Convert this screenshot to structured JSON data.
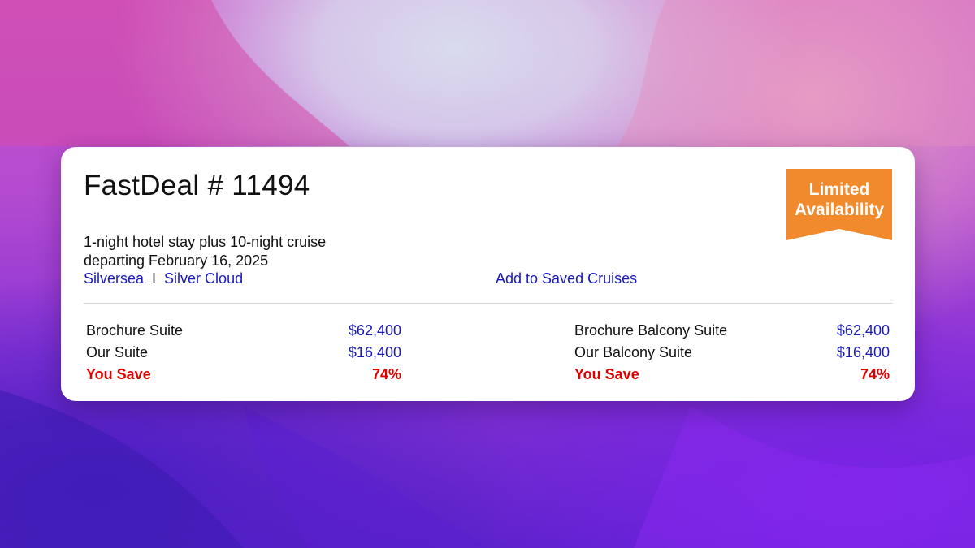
{
  "deal": {
    "title": "FastDeal # 11494",
    "description_line1": "1-night hotel stay plus 10-night cruise",
    "description_line2": "departing February 16, 2025",
    "cruise_line": "Silversea",
    "separator": "I",
    "ship": "Silver Cloud",
    "save_link": "Add to Saved Cruises"
  },
  "badge": {
    "line1": "Limited",
    "line2": "Availability",
    "color": "#f08a2c"
  },
  "pricing": [
    {
      "brochure_label": "Brochure Suite",
      "brochure_value": "$62,400",
      "our_label": "Our Suite",
      "our_value": "$16,400",
      "save_label": "You Save",
      "save_value": "74%"
    },
    {
      "brochure_label": "Brochure Balcony Suite",
      "brochure_value": "$62,400",
      "our_label": "Our Balcony Suite",
      "our_value": "$16,400",
      "save_label": "You Save",
      "save_value": "74%"
    }
  ],
  "colors": {
    "link": "#1a1ab8",
    "savings": "#e00000",
    "badge": "#f08a2c"
  }
}
